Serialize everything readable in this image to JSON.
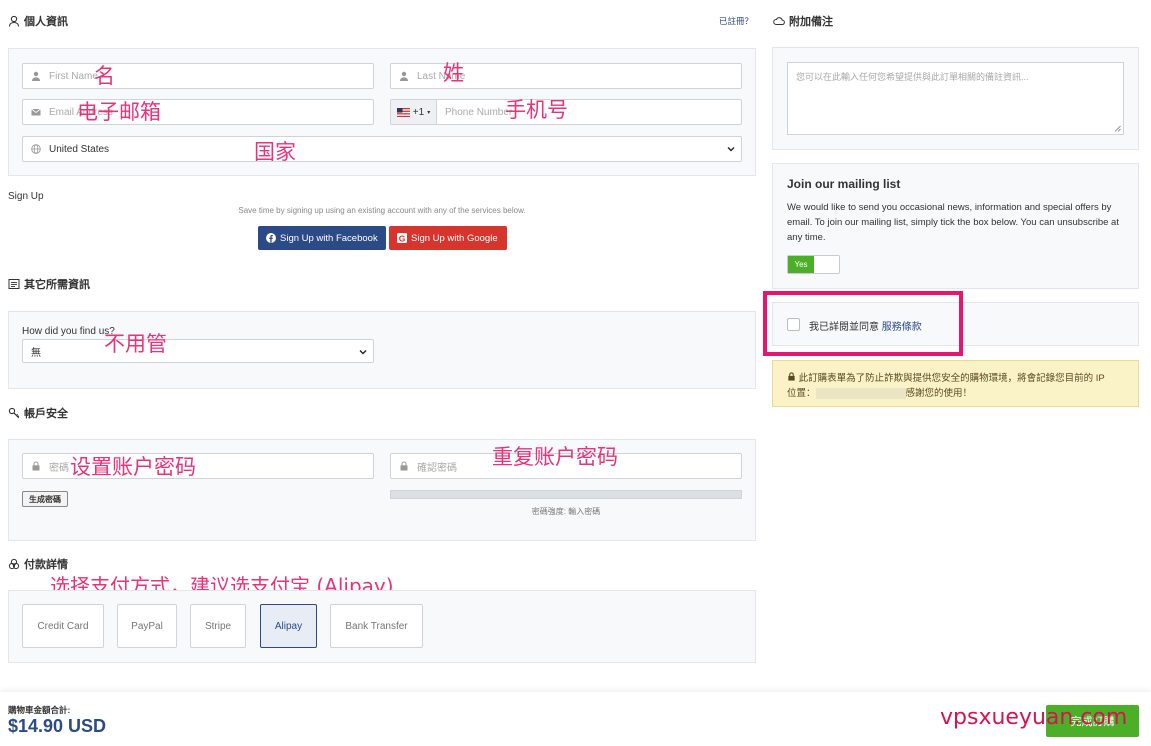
{
  "personal": {
    "heading": "個人資訊",
    "login_link": "已註冊？",
    "first_name_placeholder": "First Name",
    "last_name_placeholder": "Last Name",
    "email_placeholder": "Email Address",
    "phone_prefix": "+1",
    "phone_placeholder": "Phone Number",
    "country_value": "United States",
    "notes": {
      "first_name": "名",
      "last_name": "姓",
      "email": "电子邮箱",
      "phone": "手机号",
      "country": "国家"
    }
  },
  "signup": {
    "label": "Sign Up",
    "description": "Save time by signing up using an existing account with any of the services below.",
    "facebook_label": "Sign Up with Facebook",
    "google_label": "Sign Up with Google"
  },
  "other_info": {
    "heading": "其它所需資訊",
    "find_label": "How did you find us?",
    "find_value": "無",
    "note": "不用管"
  },
  "account_security": {
    "heading": "帳戶安全",
    "password_placeholder": "密碼",
    "confirm_placeholder": "確認密碼",
    "generate_label": "生成密碼",
    "strength_text": "密碼強度: 輸入密碼",
    "strength_value": 0,
    "notes": {
      "password": "设置账户密码",
      "confirm": "重复账户密码"
    }
  },
  "payment": {
    "heading": "付款詳情",
    "note": "选择支付方式，建议选支付宝 (Alipay)",
    "methods": [
      "Credit Card",
      "PayPal",
      "Stripe",
      "Alipay",
      "Bank Transfer"
    ],
    "selected": "Alipay"
  },
  "additional_notes": {
    "heading": "附加備注",
    "placeholder": "您可以在此輸入任何您希望提供與此訂單相關的備註資訊..."
  },
  "mailing_list": {
    "title": "Join our mailing list",
    "description": "We would like to send you occasional news, information and special offers by email. To join our mailing list, simply tick the box below. You can unsubscribe at any time.",
    "toggle_label": "Yes"
  },
  "terms": {
    "text": "我已詳閱並同意",
    "link": "服務條款"
  },
  "security_notice": {
    "line1": "此訂購表單為了防止詐欺與提供您安全的購物環境，將會記錄您目前的 IP",
    "line2_prefix": "位置：",
    "line2_suffix": "感謝您的使用！"
  },
  "footer": {
    "total_label": "購物車金額合計:",
    "total_value": "$14.90 USD",
    "checkout_label": "完成訂購",
    "watermark": "vpsxueyuan.com"
  },
  "colors": {
    "accent": "#2b4a86",
    "annotation": "#e8337a",
    "highlight_box": "#e5166f",
    "checkout": "#4caf28",
    "toggle": "#4caf28"
  }
}
